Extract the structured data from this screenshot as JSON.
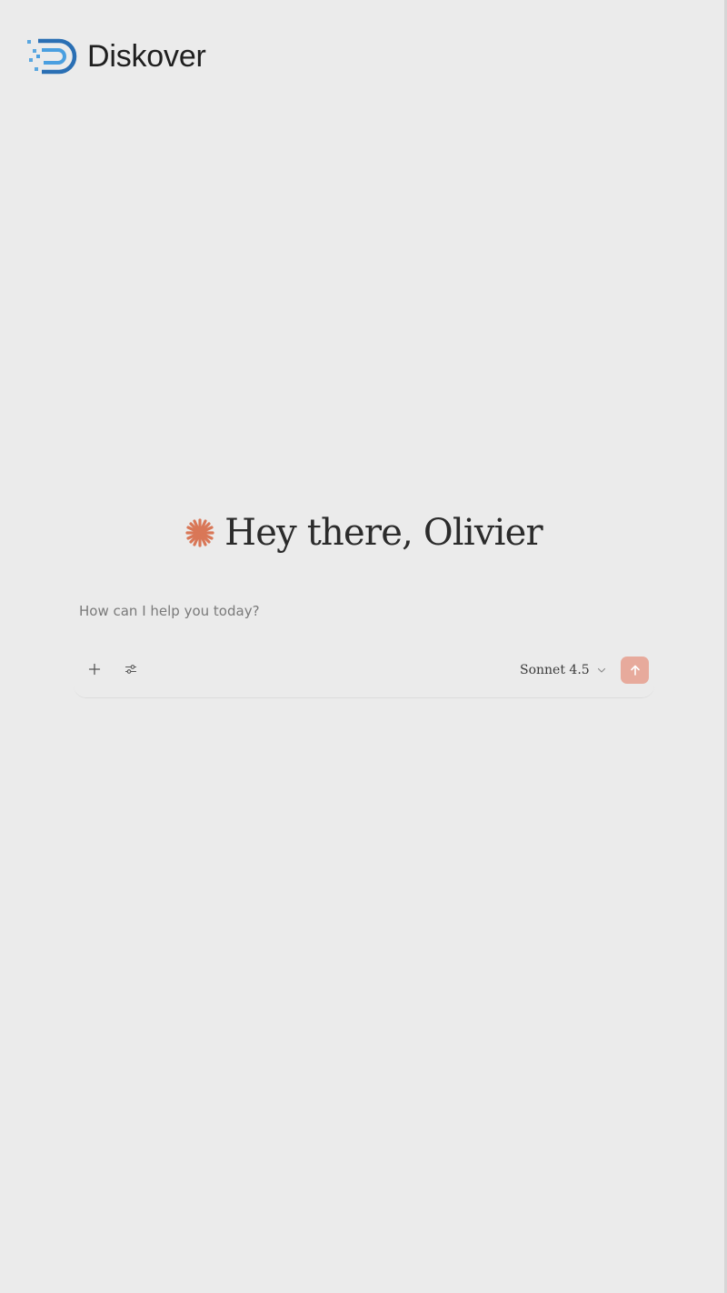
{
  "brand": {
    "name": "Diskover",
    "logo_icon": "diskover-logo-icon"
  },
  "greeting": {
    "icon": "spark-icon",
    "text": "Hey there, Olivier"
  },
  "composer": {
    "placeholder": "How can I help you today?",
    "value": "",
    "add_icon": "plus-icon",
    "tools_icon": "sliders-icon",
    "model": "Sonnet 4.5",
    "model_icon": "chevron-down-icon",
    "send_icon": "arrow-up-icon"
  },
  "colors": {
    "background": "#ebebeb",
    "accent": "#d97757",
    "send_button": "#e7aa9c",
    "brand_blue": "#2a6fb4"
  }
}
